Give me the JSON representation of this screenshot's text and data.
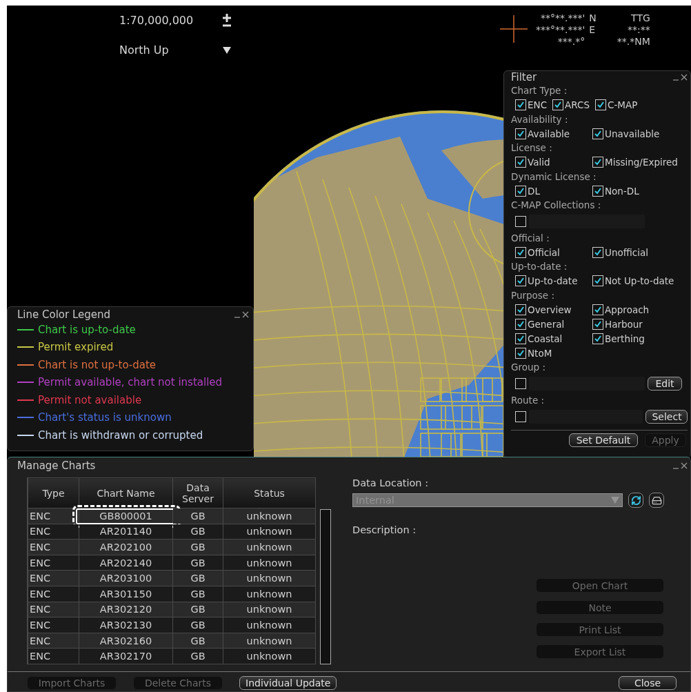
{
  "header": {
    "scale": "1:70,000,000",
    "orientation": "North Up",
    "lat": "**°**.***'",
    "lat_hemi": "N",
    "lon": "***°**.***'",
    "lon_hemi": "E",
    "course": "***.*°",
    "ttg_label": "TTG",
    "ttg": "**:**",
    "distance": "**.*NM"
  },
  "legend": {
    "title": "Line Color Legend",
    "items": [
      {
        "label": "Chart is up-to-date",
        "color": "#3ec84a"
      },
      {
        "label": "Permit expired",
        "color": "#c8c846"
      },
      {
        "label": "Chart is not up-to-date",
        "color": "#e07040"
      },
      {
        "label": "Permit available, chart not installed",
        "color": "#b040c0"
      },
      {
        "label": "Permit not available",
        "color": "#e03850"
      },
      {
        "label": "Chart's status is unknown",
        "color": "#4a6ee0"
      },
      {
        "label": "Chart is withdrawn or corrupted",
        "color": "#c8d8f0"
      }
    ]
  },
  "filter": {
    "title": "Filter",
    "sections": [
      {
        "kind": "checks",
        "label": "Chart Type :",
        "options": [
          {
            "label": "ENC",
            "checked": true
          },
          {
            "label": "ARCS",
            "checked": true
          },
          {
            "label": "C-MAP",
            "checked": true
          }
        ]
      },
      {
        "kind": "checks",
        "label": "Availability :",
        "options": [
          {
            "label": "Available",
            "checked": true
          },
          {
            "label": "Unavailable",
            "checked": true
          }
        ]
      },
      {
        "kind": "checks",
        "label": "License :",
        "options": [
          {
            "label": "Valid",
            "checked": true
          },
          {
            "label": "Missing/Expired",
            "checked": true
          }
        ]
      },
      {
        "kind": "checks",
        "label": "Dynamic License :",
        "options": [
          {
            "label": "DL",
            "checked": true
          },
          {
            "label": "Non-DL",
            "checked": true
          }
        ]
      },
      {
        "kind": "select",
        "label": "C-MAP Collections :",
        "checked": false
      },
      {
        "kind": "checks",
        "label": "Official :",
        "options": [
          {
            "label": "Official",
            "checked": true
          },
          {
            "label": "Unofficial",
            "checked": true
          }
        ]
      },
      {
        "kind": "checks",
        "label": "Up-to-date :",
        "options": [
          {
            "label": "Up-to-date",
            "checked": true
          },
          {
            "label": "Not Up-to-date",
            "checked": true
          }
        ]
      },
      {
        "kind": "checks",
        "label": "Purpose :",
        "options": [
          {
            "label": "Overview",
            "checked": true
          },
          {
            "label": "Approach",
            "checked": true
          },
          {
            "label": "General",
            "checked": true
          },
          {
            "label": "Harbour",
            "checked": true
          },
          {
            "label": "Coastal",
            "checked": true
          },
          {
            "label": "Berthing",
            "checked": true
          },
          {
            "label": "NtoM",
            "checked": true
          }
        ]
      },
      {
        "kind": "select",
        "label": "Group :",
        "checked": false,
        "button": "Edit"
      },
      {
        "kind": "select",
        "label": "Route :",
        "checked": false,
        "button": "Select"
      }
    ],
    "buttons": [
      {
        "label": "Set Default",
        "disabled": false
      },
      {
        "label": "Apply",
        "disabled": true
      }
    ]
  },
  "manage": {
    "title": "Manage Charts",
    "columns": [
      "Type",
      "Chart Name",
      "Data Server",
      "Status"
    ],
    "rows": [
      {
        "cells": [
          "ENC",
          "GB800001",
          "GB",
          "unknown"
        ],
        "highlighted": true
      },
      {
        "cells": [
          "ENC",
          "AR201140",
          "GB",
          "unknown"
        ],
        "highlighted": false
      },
      {
        "cells": [
          "ENC",
          "AR202100",
          "GB",
          "unknown"
        ],
        "highlighted": false
      },
      {
        "cells": [
          "ENC",
          "AR202140",
          "GB",
          "unknown"
        ],
        "highlighted": false
      },
      {
        "cells": [
          "ENC",
          "AR203100",
          "GB",
          "unknown"
        ],
        "highlighted": false
      },
      {
        "cells": [
          "ENC",
          "AR301150",
          "GB",
          "unknown"
        ],
        "highlighted": false
      },
      {
        "cells": [
          "ENC",
          "AR302120",
          "GB",
          "unknown"
        ],
        "highlighted": false
      },
      {
        "cells": [
          "ENC",
          "AR302130",
          "GB",
          "unknown"
        ],
        "highlighted": false
      },
      {
        "cells": [
          "ENC",
          "AR302160",
          "GB",
          "unknown"
        ],
        "highlighted": false
      },
      {
        "cells": [
          "ENC",
          "AR302170",
          "GB",
          "unknown"
        ],
        "highlighted": false
      }
    ],
    "data_location_label": "Data Location :",
    "data_location": {
      "value": "Internal",
      "disabled": true
    },
    "description_label": "Description :",
    "side_buttons": [
      {
        "label": "Open Chart",
        "disabled": true
      },
      {
        "label": "Note",
        "disabled": true
      },
      {
        "label": "Print List",
        "disabled": true
      },
      {
        "label": "Export List",
        "disabled": true
      }
    ],
    "bottom_buttons": [
      {
        "label": "Import Charts",
        "disabled": true
      },
      {
        "label": "Delete Charts",
        "disabled": true
      },
      {
        "label": "Individual Update",
        "disabled": false
      }
    ],
    "close_button": "Close"
  }
}
